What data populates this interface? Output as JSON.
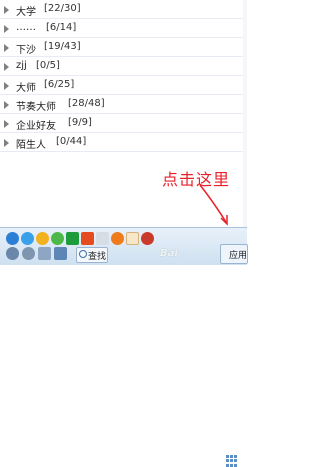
{
  "groups": [
    {
      "name": "大学",
      "count": "[22/30]",
      "name_w": 26
    },
    {
      "name": "……",
      "count": "[6/14]",
      "name_w": 26
    },
    {
      "name": "下沙",
      "count": "[19/43]",
      "name_w": 26
    },
    {
      "name": "zjj",
      "count": "[0/5]",
      "name_w": 18
    },
    {
      "name": "大师",
      "count": "[6/25]",
      "name_w": 26
    },
    {
      "name": "节奏大师",
      "count": "[28/48]",
      "name_w": 50
    },
    {
      "name": "企业好友",
      "count": "[9/9]",
      "name_w": 50
    },
    {
      "name": "陌生人",
      "count": "[0/44]",
      "name_w": 38
    }
  ],
  "annotation": "点击这里",
  "toolbar": {
    "search_label": "查找",
    "apps_label": "应用"
  },
  "watermark": "Bai"
}
